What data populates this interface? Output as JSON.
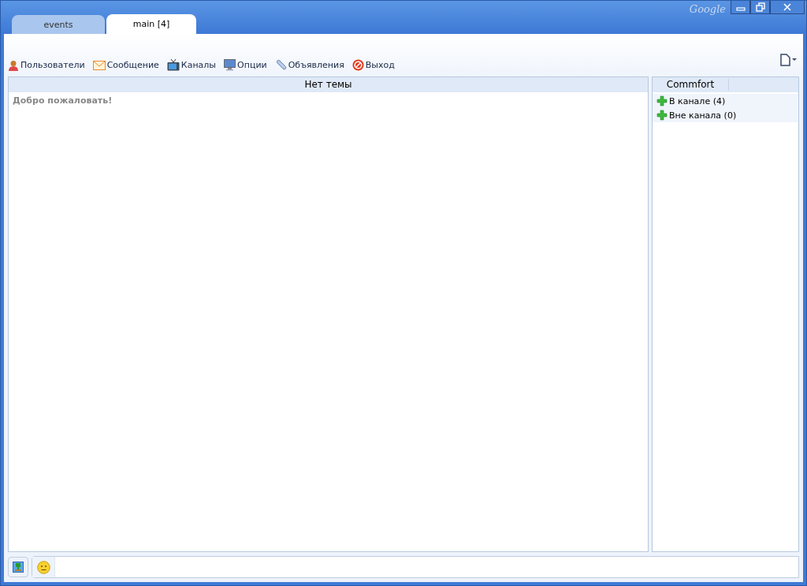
{
  "window": {
    "brand": "Google"
  },
  "tabs": [
    {
      "label": "events",
      "selected": false
    },
    {
      "label": "main [4]",
      "selected": true
    }
  ],
  "toolbar": [
    {
      "label": "Пользователи",
      "kind": "users"
    },
    {
      "label": "Сообщение",
      "kind": "mail"
    },
    {
      "label": "Каналы",
      "kind": "tv"
    },
    {
      "label": "Опции",
      "kind": "monitor"
    },
    {
      "label": "Объявления",
      "kind": "clip"
    },
    {
      "label": "Выход",
      "kind": "exit"
    }
  ],
  "chat": {
    "topic": "Нет темы",
    "messages": [
      "Добро пожаловать!"
    ]
  },
  "users_panel": {
    "title": "Commfort",
    "groups": [
      {
        "label": "В канале (4)",
        "expanded": false
      },
      {
        "label": "Вне канала (0)",
        "expanded": false
      }
    ]
  }
}
